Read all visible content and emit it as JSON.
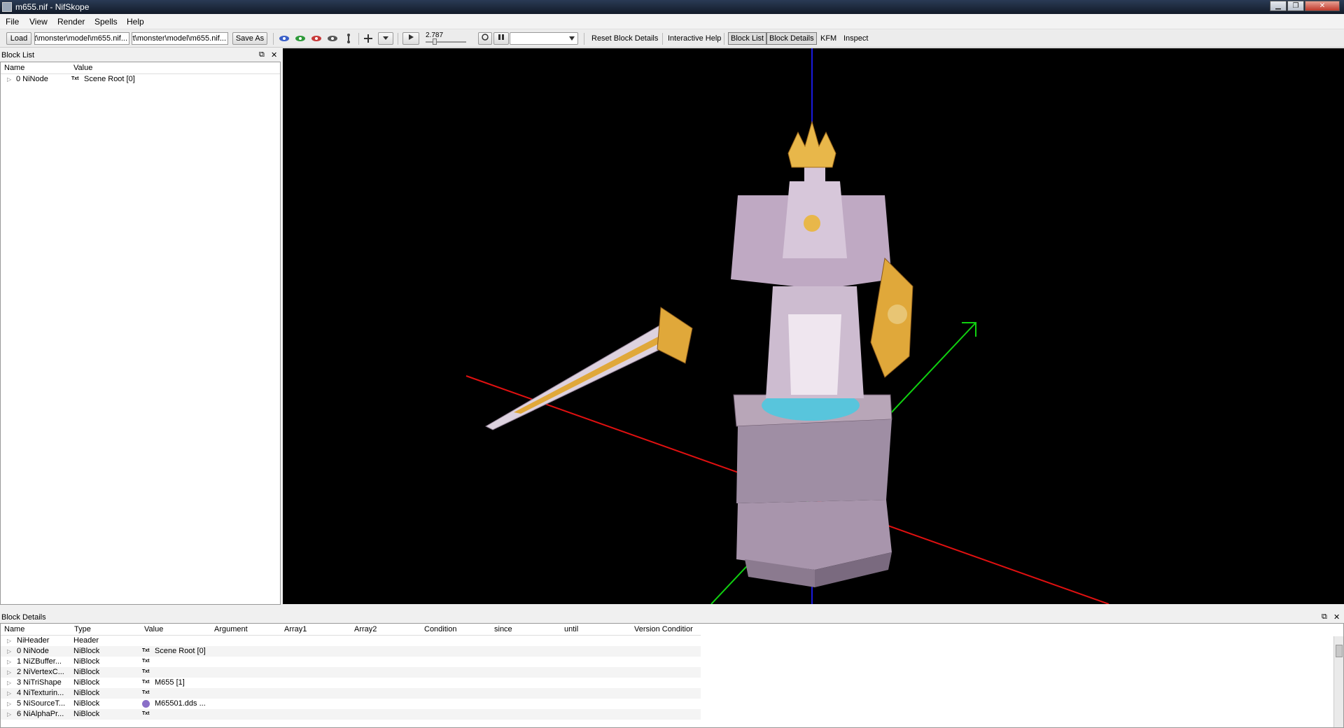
{
  "window": {
    "title": "m655.nif - NifSkope"
  },
  "menu": [
    "File",
    "View",
    "Render",
    "Spells",
    "Help"
  ],
  "toolbar": {
    "load_label": "Load",
    "load_path": "...rt\\monster\\model\\m655.nif",
    "save_path": "...rt\\monster\\model\\m655.nif",
    "save_as_label": "Save As",
    "time_value": "2.787",
    "reset_block_details": "Reset Block Details",
    "interactive_help": "Interactive Help",
    "block_list": "Block List",
    "block_details": "Block Details",
    "kfm": "KFM",
    "inspect": "Inspect"
  },
  "block_list": {
    "title": "Block List",
    "columns": [
      "Name",
      "Value"
    ],
    "rows": [
      {
        "name": "0 NiNode",
        "value": "Scene Root [0]",
        "tag": "Txt"
      }
    ]
  },
  "block_details": {
    "title": "Block Details",
    "columns": [
      "Name",
      "Type",
      "Value",
      "Argument",
      "Array1",
      "Array2",
      "Condition",
      "since",
      "until",
      "Version Conditior"
    ],
    "rows": [
      {
        "name": "NiHeader",
        "type": "Header",
        "tag": "",
        "value": ""
      },
      {
        "name": "0 NiNode",
        "type": "NiBlock",
        "tag": "Txt",
        "value": "Scene Root [0]"
      },
      {
        "name": "1 NiZBuffer...",
        "type": "NiBlock",
        "tag": "Txt",
        "value": ""
      },
      {
        "name": "2 NiVertexC...",
        "type": "NiBlock",
        "tag": "Txt",
        "value": ""
      },
      {
        "name": "3 NiTriShape",
        "type": "NiBlock",
        "tag": "Txt",
        "value": "M655 [1]"
      },
      {
        "name": "4 NiTexturin...",
        "type": "NiBlock",
        "tag": "Txt",
        "value": ""
      },
      {
        "name": "5 NiSourceT...",
        "type": "NiBlock",
        "tag": "img",
        "value": "M65501.dds ..."
      },
      {
        "name": "6 NiAlphaPr...",
        "type": "NiBlock",
        "tag": "Txt",
        "value": ""
      }
    ]
  },
  "colors": {
    "axis_x": "#e01010",
    "axis_y": "#10d010",
    "axis_z": "#1010e0",
    "viewport_bg": "#000000"
  }
}
